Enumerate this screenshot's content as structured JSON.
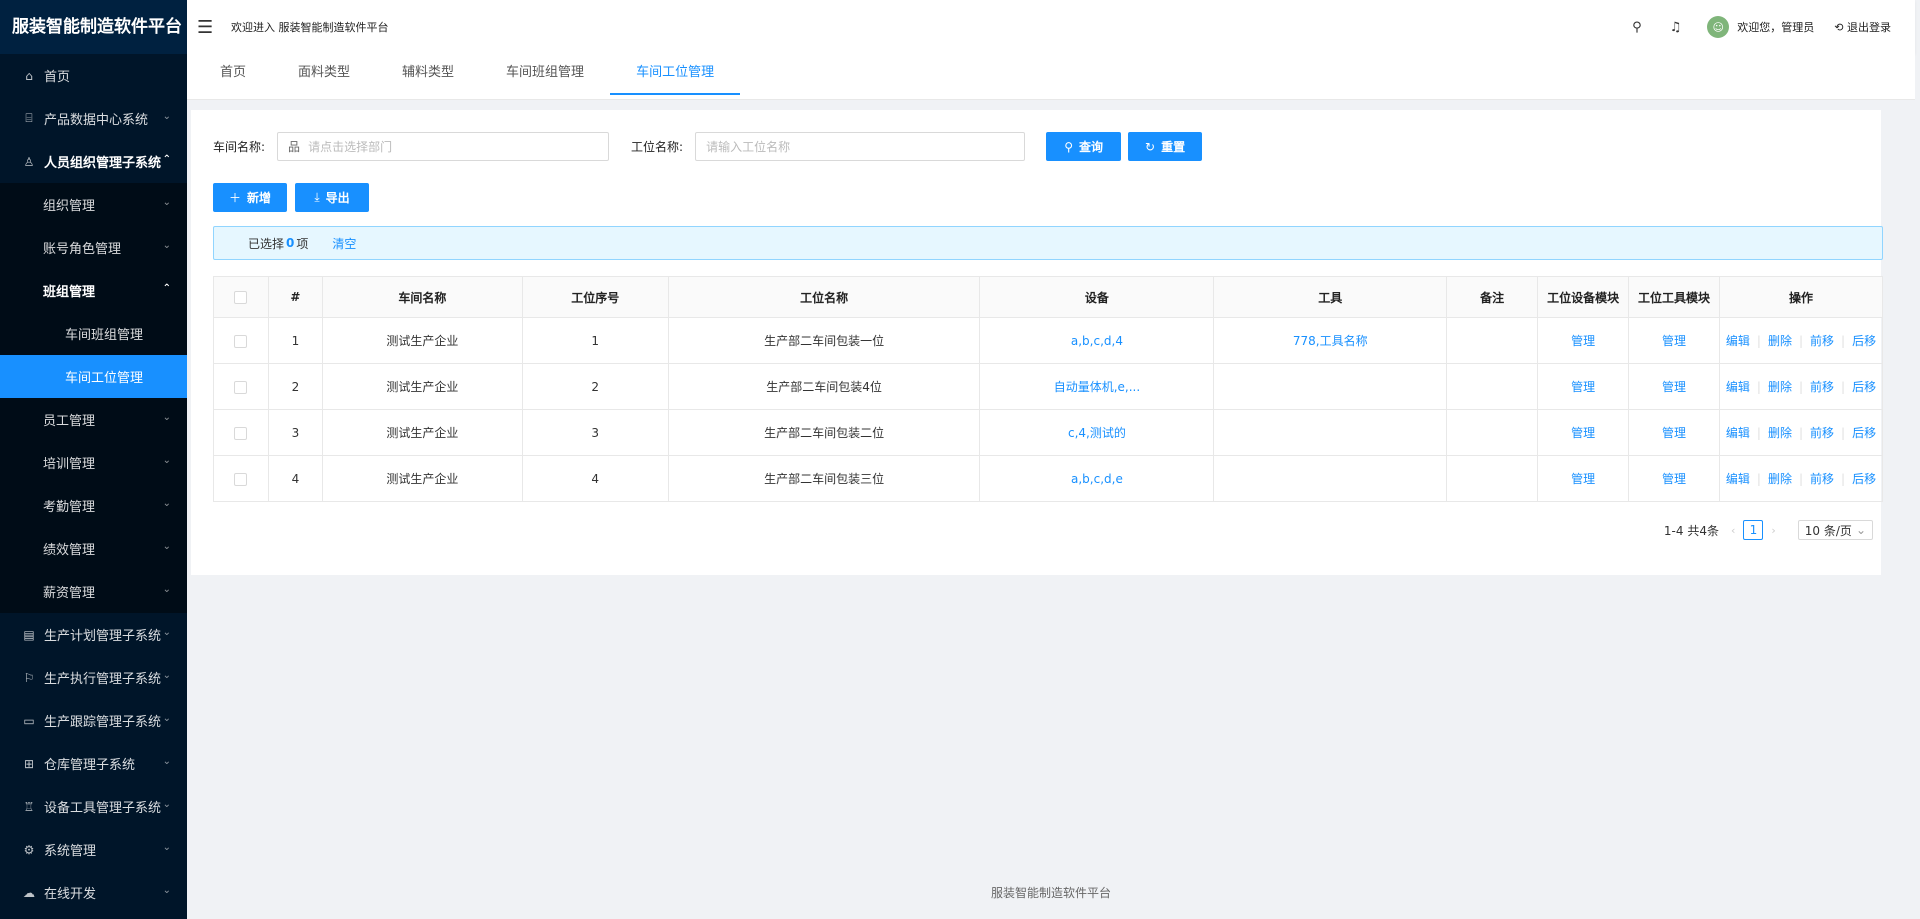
{
  "app": {
    "title": "服装智能制造软件平台"
  },
  "header": {
    "welcome": "欢迎进入 服装智能制造软件平台",
    "user_greeting": "欢迎您，管理员",
    "logout": "退出登录"
  },
  "sidebar": {
    "items": [
      {
        "label": "首页",
        "icon": "home-icon"
      },
      {
        "label": "产品数据中心系统",
        "icon": "bank-icon"
      },
      {
        "label": "人员组织管理子系统",
        "icon": "user-icon"
      },
      {
        "label": "组织管理"
      },
      {
        "label": "账号角色管理"
      },
      {
        "label": "班组管理"
      },
      {
        "label": "车间班组管理"
      },
      {
        "label": "车间工位管理"
      },
      {
        "label": "员工管理"
      },
      {
        "label": "培训管理"
      },
      {
        "label": "考勤管理"
      },
      {
        "label": "绩效管理"
      },
      {
        "label": "薪资管理"
      },
      {
        "label": "生产计划管理子系统",
        "icon": "file-icon"
      },
      {
        "label": "生产执行管理子系统",
        "icon": "flag-icon"
      },
      {
        "label": "生产跟踪管理子系统",
        "icon": "monitor-icon"
      },
      {
        "label": "仓库管理子系统",
        "icon": "grid-icon"
      },
      {
        "label": "设备工具管理子系统",
        "icon": "tool-icon"
      },
      {
        "label": "系统管理",
        "icon": "gear-icon"
      },
      {
        "label": "在线开发",
        "icon": "cloud-icon"
      }
    ]
  },
  "tabs": [
    "首页",
    "面料类型",
    "辅料类型",
    "车间班组管理",
    "车间工位管理"
  ],
  "search": {
    "workshop_label": "车间名称:",
    "workshop_placeholder": "请点击选择部门",
    "station_label": "工位名称:",
    "station_placeholder": "请输入工位名称",
    "query": "查询",
    "reset": "重置"
  },
  "toolbar": {
    "add": "新增",
    "export": "导出"
  },
  "selection": {
    "prefix": "已选择",
    "count": "0",
    "suffix": "项",
    "clear": "清空"
  },
  "table": {
    "headers": [
      "#",
      "车间名称",
      "工位序号",
      "工位名称",
      "设备",
      "工具",
      "备注",
      "工位设备模块",
      "工位工具模块",
      "操作"
    ],
    "rows": [
      {
        "idx": "1",
        "workshop": "测试生产企业",
        "seq": "1",
        "name": "生产部二车间包装一位",
        "device": "a,b,c,d,4",
        "tool": "778,工具名称",
        "remark": "",
        "device_mod": "管理",
        "tool_mod": "管理"
      },
      {
        "idx": "2",
        "workshop": "测试生产企业",
        "seq": "2",
        "name": "生产部二车间包装4位",
        "device": "自动量体机,e,...",
        "tool": "",
        "remark": "",
        "device_mod": "管理",
        "tool_mod": "管理"
      },
      {
        "idx": "3",
        "workshop": "测试生产企业",
        "seq": "3",
        "name": "生产部二车间包装二位",
        "device": "c,4,测试的",
        "tool": "",
        "remark": "",
        "device_mod": "管理",
        "tool_mod": "管理"
      },
      {
        "idx": "4",
        "workshop": "测试生产企业",
        "seq": "4",
        "name": "生产部二车间包装三位",
        "device": "a,b,c,d,e",
        "tool": "",
        "remark": "",
        "device_mod": "管理",
        "tool_mod": "管理"
      }
    ],
    "ops": [
      "编辑",
      "删除",
      "前移",
      "后移"
    ]
  },
  "pagination": {
    "total": "1-4 共4条",
    "current": "1",
    "page_size": "10 条/页"
  },
  "footer": "服装智能制造软件平台",
  "colors": {
    "primary": "#1890ff",
    "sidebar_bg": "#001529"
  }
}
